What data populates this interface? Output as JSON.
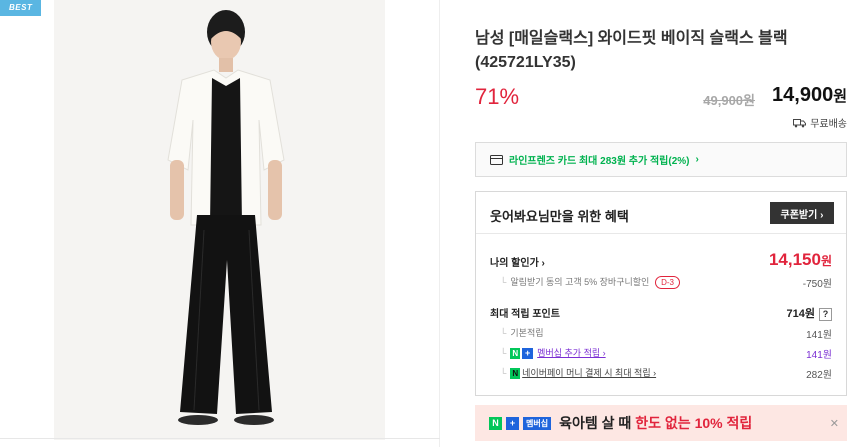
{
  "image": {
    "badge": "BEST"
  },
  "product": {
    "title": "남성 [매일슬랙스] 와이드핏 베이직 슬랙스 블랙 (425721LY35)",
    "discount": "71%",
    "original_price": "49,900원",
    "price": "14,900",
    "price_unit": "원",
    "shipping": "무료배송"
  },
  "card_promo": {
    "text": "라인프렌즈 카드 최대 283원 추가 적립(2%)",
    "chevron": "›"
  },
  "benefit": {
    "title": "웃어봐요님만을 위한 혜택",
    "coupon_button": "쿠폰받기 ›",
    "my_discount_label": "나의 할인가 ›",
    "my_discount_price": "14,150",
    "my_discount_unit": "원",
    "alert_text": "알림받기 동의 고객 5% 장바구니할인",
    "alert_badge": "D-3",
    "alert_amount": "-750원",
    "points_label": "최대 적립 포인트",
    "points_value": "714원",
    "points_help": "?",
    "basic_label": "기본적립",
    "basic_value": "141원",
    "membership_label": "멤버십 추가 적립 ›",
    "membership_value": "141원",
    "npay_label": "네이버페이 머니 결제 시 최대 적립 ›",
    "npay_value": "282원"
  },
  "banner": {
    "n_icon": "N +",
    "membership_tag": "멤버십",
    "text_dark": "육아템 살 때",
    "text_red": "한도 없는 10% 적립",
    "close": "✕"
  }
}
